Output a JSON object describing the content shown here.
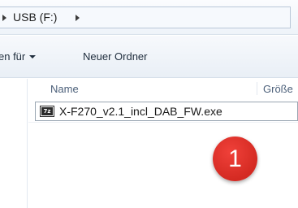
{
  "breadcrumb": {
    "location": "USB (F:)"
  },
  "toolbar": {
    "share_label": "en für",
    "new_folder_label": "Neuer Ordner"
  },
  "file_list": {
    "columns": [
      "Name",
      "Größe"
    ],
    "rows": [
      {
        "name": "X-F270_v2.1_incl_DAB_FW.exe",
        "icon": "7z-archive-icon"
      }
    ]
  },
  "annotation": {
    "step_number": "1",
    "badge_color": "#e0342c"
  }
}
